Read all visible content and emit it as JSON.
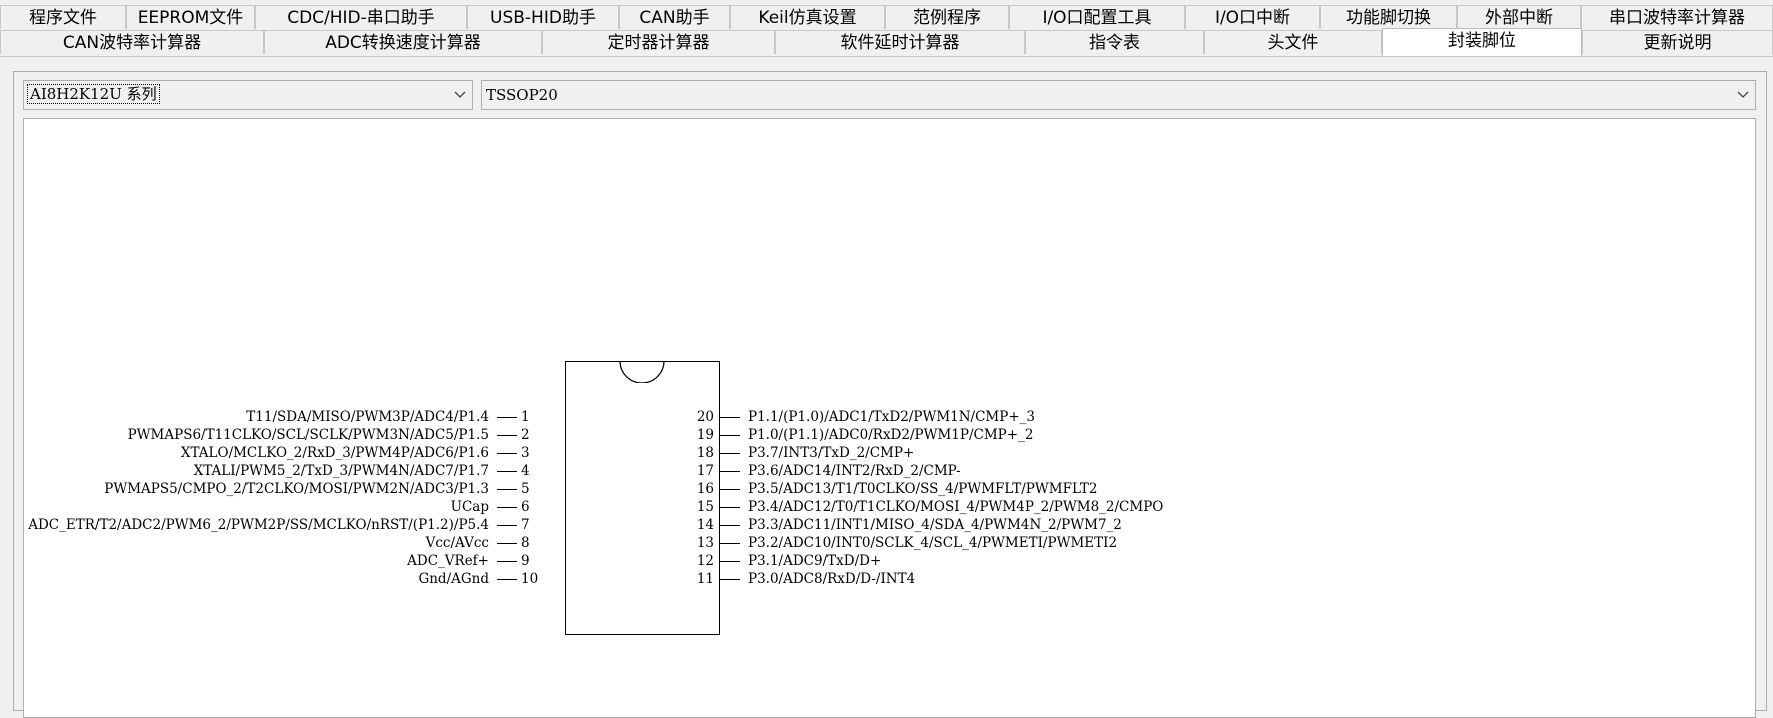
{
  "tabs": {
    "row1": [
      "程序文件",
      "EEPROM文件",
      "CDC/HID-串口助手",
      "USB-HID助手",
      "CAN助手",
      "Keil仿真设置",
      "范例程序",
      "I/O口配置工具",
      "I/O口中断",
      "功能脚切换",
      "外部中断",
      "串口波特率计算器"
    ],
    "row2": [
      "CAN波特率计算器",
      "ADC转换速度计算器",
      "定时器计算器",
      "软件延时计算器",
      "指令表",
      "头文件",
      "封装脚位",
      "更新说明"
    ],
    "active": "封装脚位"
  },
  "selectors": {
    "series": "AI8H2K12U 系列",
    "package": "TSSOP20"
  },
  "icons": {
    "dropdown": "chevron-down-icon"
  },
  "chip": {
    "left_pins": [
      {
        "num": "1",
        "name": "T11/SDA/MISO/PWM3P/ADC4/P1.4"
      },
      {
        "num": "2",
        "name": "PWMAPS6/T11CLKO/SCL/SCLK/PWM3N/ADC5/P1.5"
      },
      {
        "num": "3",
        "name": "XTALO/MCLKO_2/RxD_3/PWM4P/ADC6/P1.6"
      },
      {
        "num": "4",
        "name": "XTALI/PWM5_2/TxD_3/PWM4N/ADC7/P1.7"
      },
      {
        "num": "5",
        "name": "PWMAPS5/CMPO_2/T2CLKO/MOSI/PWM2N/ADC3/P1.3"
      },
      {
        "num": "6",
        "name": "UCap"
      },
      {
        "num": "7",
        "name": "ADC_ETR/T2/ADC2/PWM6_2/PWM2P/SS/MCLKO/nRST/(P1.2)/P5.4"
      },
      {
        "num": "8",
        "name": "Vcc/AVcc"
      },
      {
        "num": "9",
        "name": "ADC_VRef+"
      },
      {
        "num": "10",
        "name": "Gnd/AGnd"
      }
    ],
    "right_pins": [
      {
        "num": "20",
        "name": "P1.1/(P1.0)/ADC1/TxD2/PWM1N/CMP+_3"
      },
      {
        "num": "19",
        "name": "P1.0/(P1.1)/ADC0/RxD2/PWM1P/CMP+_2"
      },
      {
        "num": "18",
        "name": "P3.7/INT3/TxD_2/CMP+"
      },
      {
        "num": "17",
        "name": "P3.6/ADC14/INT2/RxD_2/CMP-"
      },
      {
        "num": "16",
        "name": "P3.5/ADC13/T1/T0CLKO/SS_4/PWMFLT/PWMFLT2"
      },
      {
        "num": "15",
        "name": "P3.4/ADC12/T0/T1CLKO/MOSI_4/PWM4P_2/PWM8_2/CMPO"
      },
      {
        "num": "14",
        "name": "P3.3/ADC11/INT1/MISO_4/SDA_4/PWM4N_2/PWM7_2"
      },
      {
        "num": "13",
        "name": "P3.2/ADC10/INT0/SCLK_4/SCL_4/PWMETI/PWMETI2"
      },
      {
        "num": "12",
        "name": "P3.1/ADC9/TxD/D+"
      },
      {
        "num": "11",
        "name": "P3.0/ADC8/RxD/D-/INT4"
      }
    ]
  }
}
